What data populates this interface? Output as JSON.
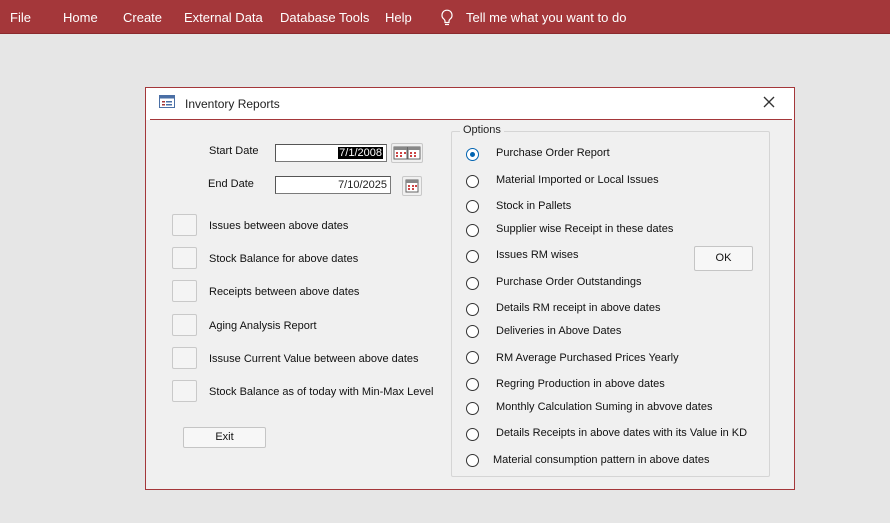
{
  "menu": [
    "File",
    "Home",
    "Create",
    "External Data",
    "Database Tools",
    "Help"
  ],
  "tell_me": "Tell me what you want to do",
  "dialog": {
    "title": "Inventory Reports",
    "start_date_label": "Start Date",
    "start_date_value": "7/1/2008",
    "end_date_label": "End Date",
    "end_date_value": "7/10/2025",
    "reports": [
      {
        "label": "Issues between above dates"
      },
      {
        "label": "Stock Balance for above dates"
      },
      {
        "label": "Receipts between above dates"
      },
      {
        "label": "Aging Analysis Report"
      },
      {
        "label": "Issuse Current Value  between above dates"
      },
      {
        "label": "Stock Balance as of today with Min-Max Level"
      }
    ],
    "exit_label": "Exit",
    "ok_label": "OK",
    "options_label": "Options",
    "options": [
      {
        "label": "Purchase Order Report",
        "selected": true
      },
      {
        "label": "Material Imported or Local Issues",
        "selected": false
      },
      {
        "label": "Stock in Pallets",
        "selected": false
      },
      {
        "label": "Supplier wise Receipt in these dates",
        "selected": false
      },
      {
        "label": "Issues RM wises",
        "selected": false
      },
      {
        "label": "Purchase Order Outstandings",
        "selected": false
      },
      {
        "label": "Details RM receipt in above dates",
        "selected": false
      },
      {
        "label": "Deliveries in Above Dates",
        "selected": false
      },
      {
        "label": "RM Average Purchased Prices Yearly",
        "selected": false
      },
      {
        "label": "Regring Production in above dates",
        "selected": false
      },
      {
        "label": "Monthly Calculation Suming in abvove dates",
        "selected": false
      },
      {
        "label": "Details Receipts in above dates with its Value in KD",
        "selected": false
      },
      {
        "label": "Material consumption pattern in above dates",
        "selected": false
      }
    ]
  },
  "colors": {
    "accent": "#a4373a",
    "radio_selected": "#0063b1"
  }
}
